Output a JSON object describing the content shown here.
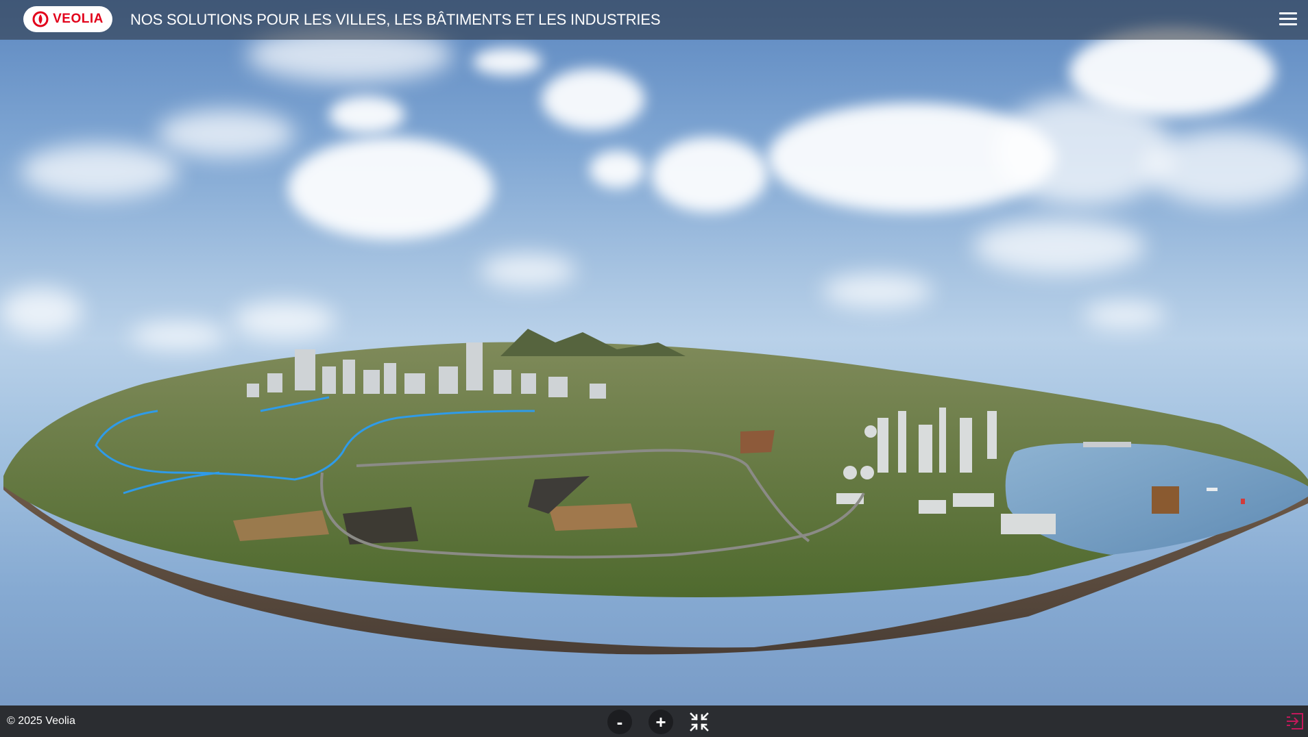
{
  "header": {
    "logo_text": "VEOLIA",
    "title": "NOS SOLUTIONS POUR LES VILLES, LES BÂTIMENTS ET LES INDUSTRIES",
    "menu_icon": "hamburger-menu-icon"
  },
  "footer": {
    "copyright": "© 2025 Veolia",
    "zoom_out_label": "-",
    "zoom_in_label": "+",
    "collapse_icon": "collapse-arrows-icon",
    "exit_icon": "exit-door-icon"
  },
  "colors": {
    "brand_red": "#e2001a",
    "header_bg": "rgba(40,48,58,0.55)",
    "footer_bg": "#2b2d31",
    "exit_icon": "#c2185b"
  }
}
